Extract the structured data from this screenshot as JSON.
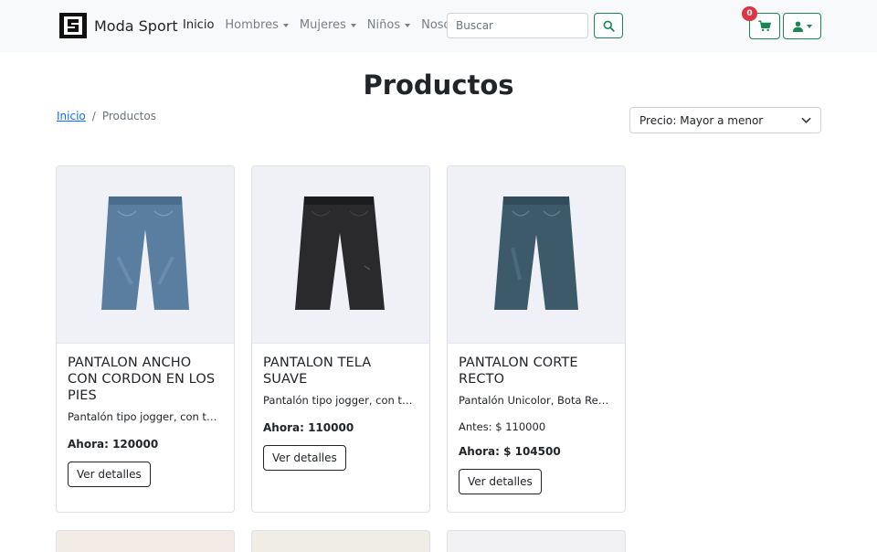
{
  "brand": {
    "name": "Moda Sport",
    "logo_icon": "moda-sport-logo"
  },
  "nav": {
    "items": [
      {
        "label": "Inicio",
        "active": true,
        "dropdown": false
      },
      {
        "label": "Hombres",
        "active": false,
        "dropdown": true
      },
      {
        "label": "Mujeres",
        "active": false,
        "dropdown": true
      },
      {
        "label": "Niños",
        "active": false,
        "dropdown": true
      },
      {
        "label": "Nosotros",
        "active": false,
        "dropdown": false
      }
    ],
    "search_placeholder": "Buscar",
    "cart_count": "0",
    "accent_color": "#198754",
    "badge_color": "#dc3545"
  },
  "page": {
    "title": "Productos"
  },
  "breadcrumb": {
    "home": "Inicio",
    "separator": "/",
    "current": "Productos"
  },
  "sort": {
    "selected": "Precio: Mayor a menor"
  },
  "products": [
    {
      "title": "PANTALON ANCHO CON CORDON EN LOS PIES",
      "description": "Pantalón tipo jogger, con tejido",
      "old_price": "",
      "price": "Ahora: 120000",
      "button": "Ver detalles",
      "jean_color": "#5a7ea0"
    },
    {
      "title": "PANTALON TELA SUAVE",
      "description": "Pantalón tipo jogger, con tejido",
      "old_price": "",
      "price": "Ahora: 110000",
      "button": "Ver detalles",
      "jean_color": "#2a2a2c"
    },
    {
      "title": "PANTALON CORTE RECTO",
      "description": "Pantalón Unicolor, Bota Recta, Tiro",
      "old_price": "Antes: $ 110000",
      "price": "Ahora: $ 104500",
      "button": "Ver detalles",
      "jean_color": "#3d5a6b"
    }
  ]
}
